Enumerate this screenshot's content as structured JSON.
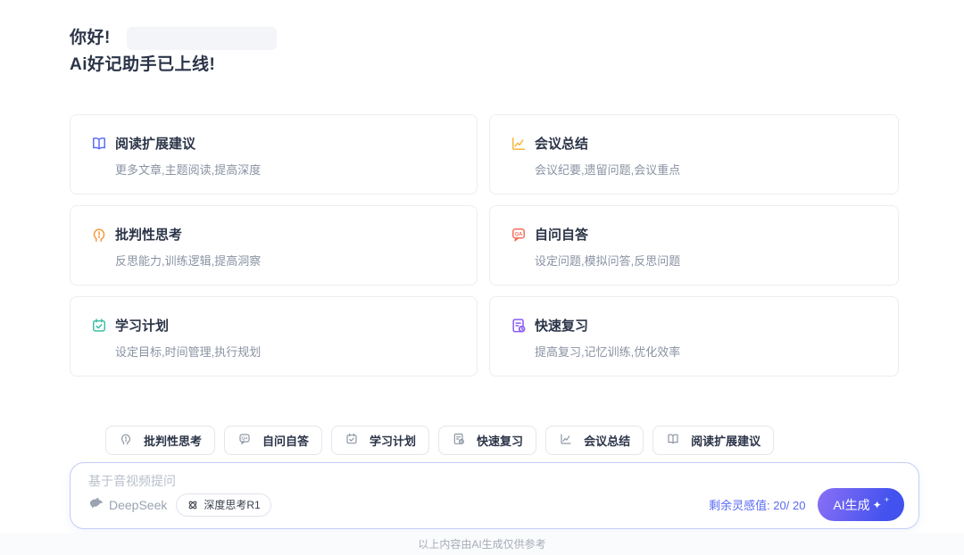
{
  "header": {
    "greeting": "你好!",
    "headline": "Ai好记助手已上线!"
  },
  "cards": [
    {
      "title": "阅读扩展建议",
      "desc": "更多文章,主题阅读,提高深度",
      "icon": "book-icon",
      "color": "#5b6cf9"
    },
    {
      "title": "会议总结",
      "desc": "会议纪要,遗留问题,会议重点",
      "icon": "line-chart-icon",
      "color": "#f5b83e"
    },
    {
      "title": "批判性思考",
      "desc": "反思能力,训练逻辑,提高洞察",
      "icon": "head-exclamation-icon",
      "color": "#f59a3e"
    },
    {
      "title": "自问自答",
      "desc": "设定问题,模拟问答,反思问题",
      "icon": "qa-bubble-icon",
      "color": "#f56f5b"
    },
    {
      "title": "学习计划",
      "desc": "设定目标,时间管理,执行规划",
      "icon": "calendar-check-icon",
      "color": "#3cbfa4"
    },
    {
      "title": "快速复习",
      "desc": "提高复习,记忆训练,优化效率",
      "icon": "doc-clock-icon",
      "color": "#8b5cf6"
    }
  ],
  "chips": [
    "批判性思考",
    "自问自答",
    "学习计划",
    "快速复习",
    "会议总结",
    "阅读扩展建议"
  ],
  "composer": {
    "placeholder": "基于音视频提问",
    "model_name": "DeepSeek",
    "mode_pill": "深度思考R1",
    "credits_label": "剩余灵感值: 20/ 20",
    "generate_button": "AI生成",
    "sparkle": "✦",
    "sparkle_plus": "+",
    "accent_color": "#5a6af2",
    "button_gradient": [
      "#8a70f5",
      "#4152ee"
    ]
  },
  "footer": {
    "disclaimer": "以上内容由AI生成仅供参考"
  }
}
